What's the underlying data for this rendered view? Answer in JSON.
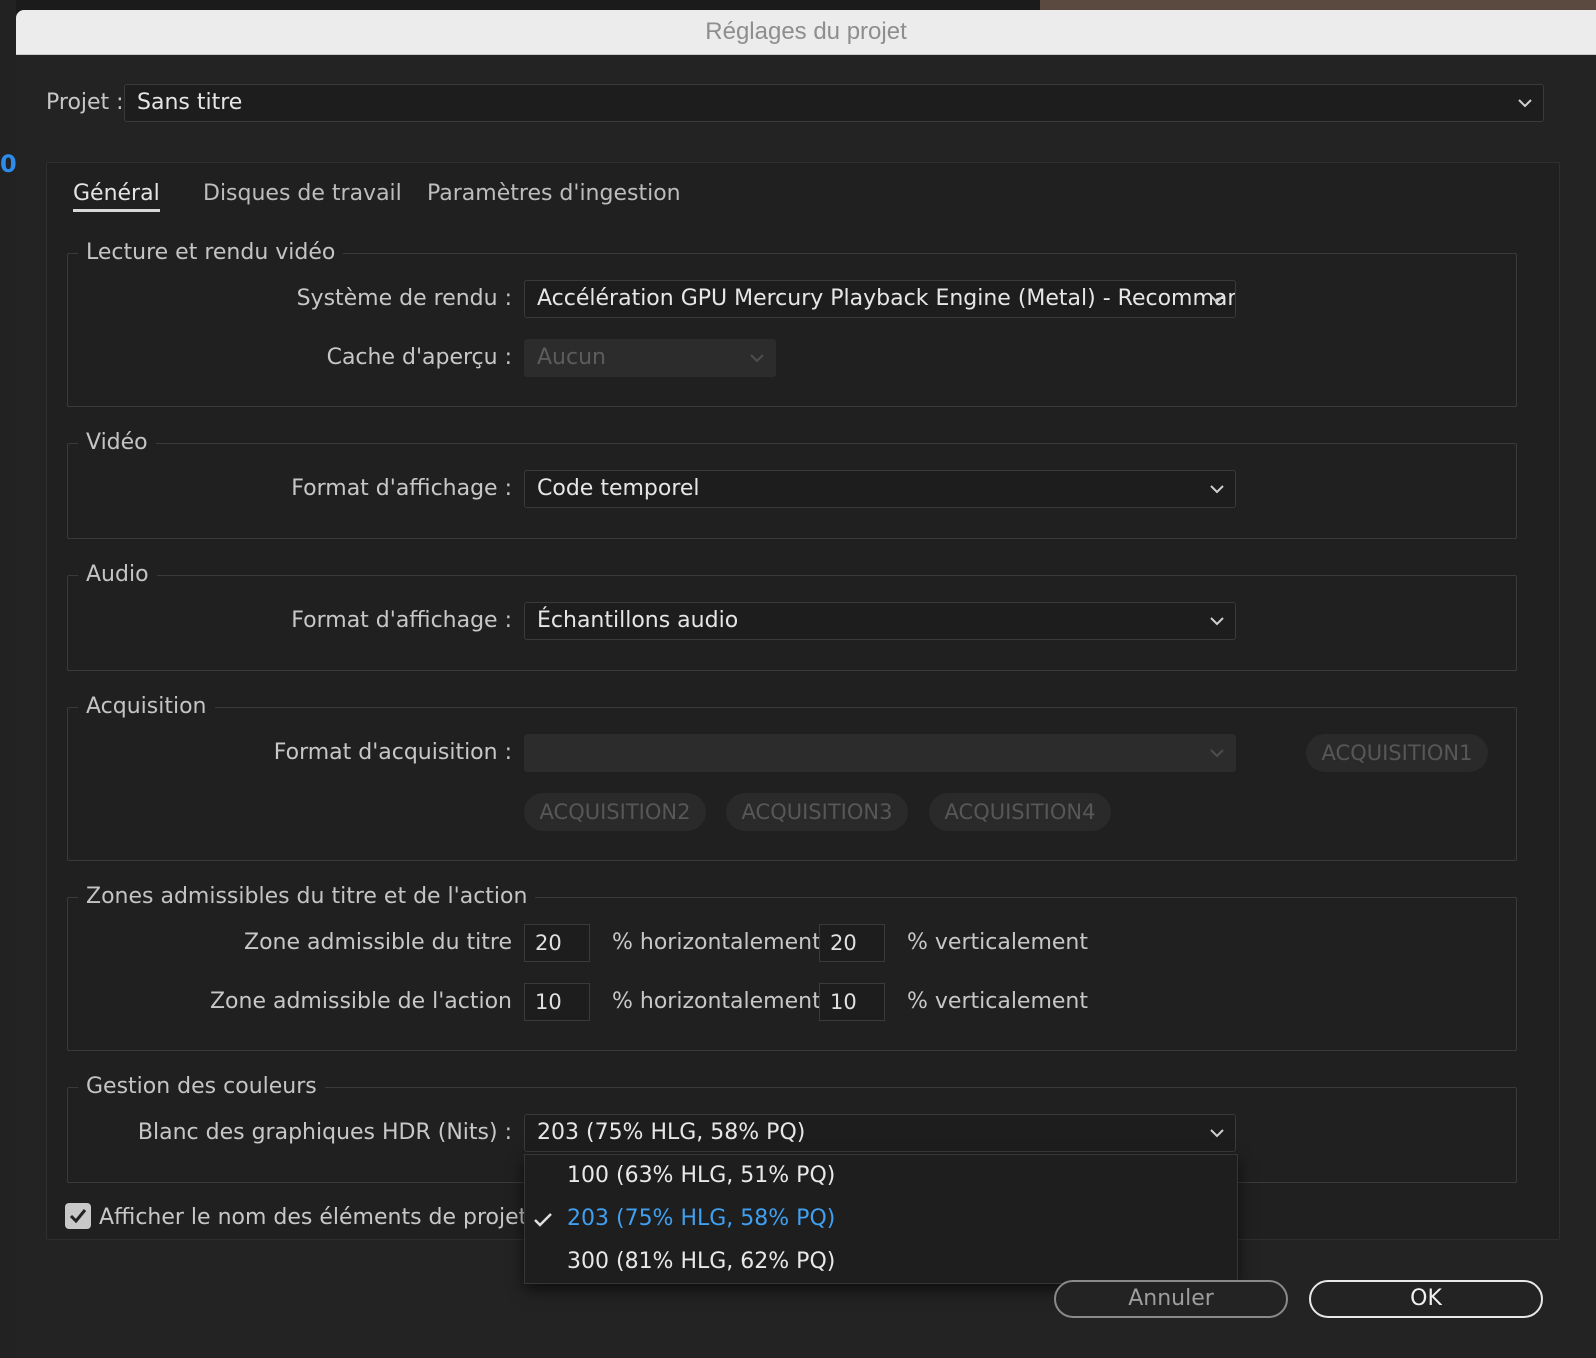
{
  "window_title": "Réglages du projet",
  "project": {
    "label": "Projet :",
    "value": "Sans titre"
  },
  "tabs": [
    {
      "label": "Général",
      "active": true
    },
    {
      "label": "Disques de travail",
      "active": false
    },
    {
      "label": "Paramètres d'ingestion",
      "active": false
    }
  ],
  "sections": {
    "playback": {
      "title": "Lecture et rendu vidéo",
      "renderer_label": "Système de rendu :",
      "renderer_value": "Accélération GPU Mercury Playback Engine (Metal) - Recommandé",
      "cache_label": "Cache d'aperçu :",
      "cache_value": "Aucun"
    },
    "video": {
      "title": "Vidéo",
      "format_label": "Format d'affichage :",
      "format_value": "Code temporel"
    },
    "audio": {
      "title": "Audio",
      "format_label": "Format d'affichage :",
      "format_value": "Échantillons audio"
    },
    "acquisition": {
      "title": "Acquisition",
      "format_label": "Format d'acquisition :",
      "format_value": "",
      "buttons": [
        "ACQUISITION1",
        "ACQUISITION2",
        "ACQUISITION3",
        "ACQUISITION4"
      ]
    },
    "safe_zones": {
      "title": "Zones admissibles du titre et de l'action",
      "title_zone_label": "Zone admissible du titre",
      "title_h": "20",
      "title_v": "20",
      "action_zone_label": "Zone admissible de l'action",
      "action_h": "10",
      "action_v": "10",
      "h_suffix": "% horizontalement",
      "v_suffix": "% verticalement"
    },
    "color": {
      "title": "Gestion des couleurs",
      "hdr_label": "Blanc des graphiques HDR (Nits) :",
      "hdr_value": "203 (75% HLG, 58% PQ)",
      "options": [
        {
          "label": "100 (63% HLG, 51% PQ)",
          "selected": false
        },
        {
          "label": "203 (75% HLG, 58% PQ)",
          "selected": true
        },
        {
          "label": "300 (81% HLG, 62% PQ)",
          "selected": false
        }
      ]
    }
  },
  "show_names_checkbox": {
    "label": "Afficher le nom des éléments de projet et la",
    "checked": true
  },
  "buttons": {
    "cancel": "Annuler",
    "ok": "OK"
  },
  "colors": {
    "accent": "#3f9ff0",
    "background": "#232323",
    "titlebar": "#ececec"
  }
}
